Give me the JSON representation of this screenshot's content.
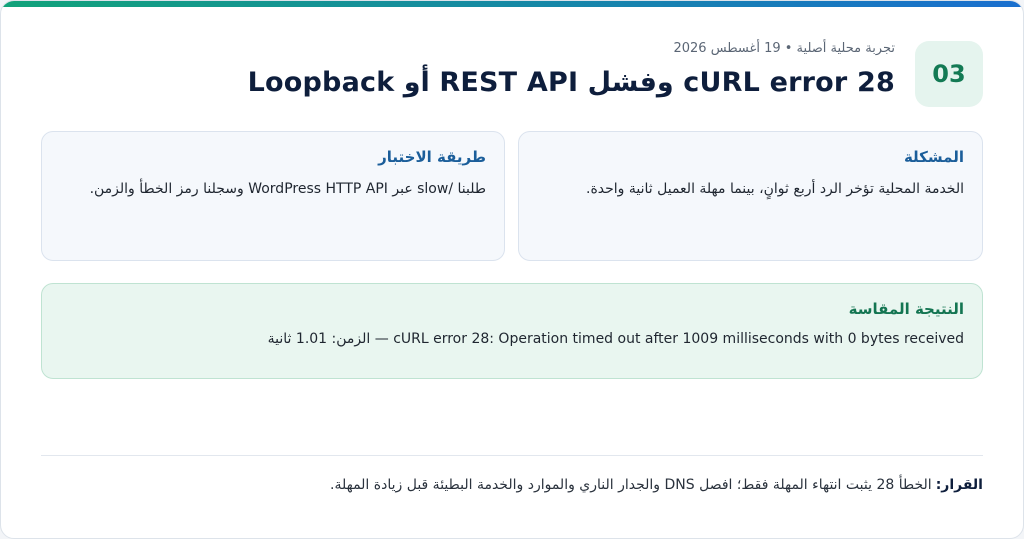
{
  "header": {
    "number": "03",
    "meta": "تجربة محلية أصلية • 19 أغسطس 2026",
    "title": "cURL error 28 وفشل REST API أو Loopback"
  },
  "problem": {
    "heading": "المشكلة",
    "text": "الخدمة المحلية تؤخر الرد أربع ثوانٍ، بينما مهلة العميل ثانية واحدة."
  },
  "method": {
    "heading": "طريقة الاختبار",
    "text": "طلبنا /slow عبر WordPress HTTP API وسجلنا رمز الخطأ والزمن."
  },
  "result": {
    "heading": "النتيجة المقاسة",
    "text": "cURL error 28: Operation timed out after 1009 milliseconds with 0 bytes received — الزمن: 1.01 ثانية"
  },
  "decision": {
    "label": "القرار:",
    "text": "الخطأ 28 يثبت انتهاء المهلة فقط؛ افصل DNS والجدار الناري والموارد والخدمة البطيئة قبل زيادة المهلة."
  },
  "colors": {
    "accent_blue": "#1a6fcf",
    "accent_green": "#12a37a",
    "title": "#0e1e3c"
  }
}
